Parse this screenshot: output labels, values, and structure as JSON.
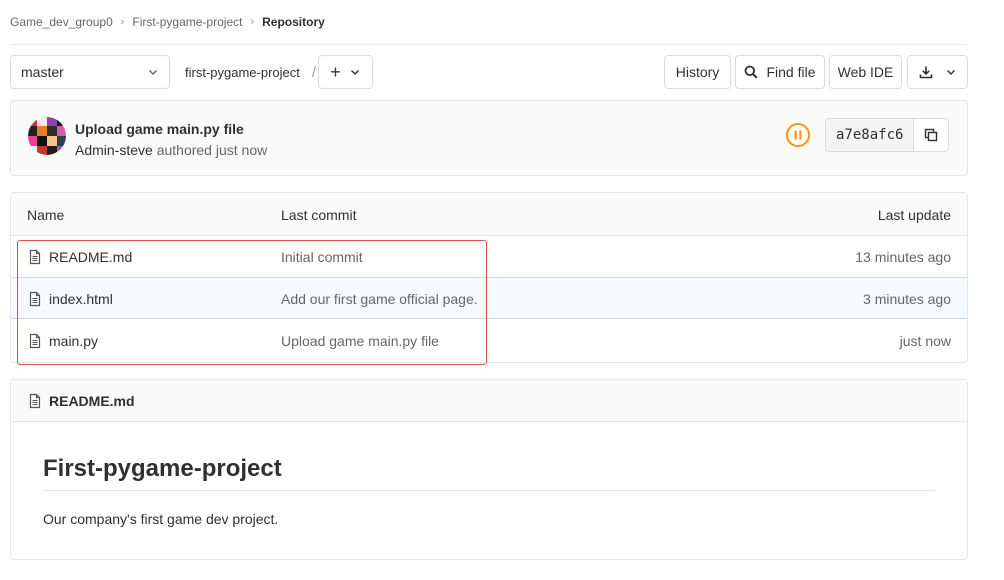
{
  "breadcrumb": {
    "items": [
      "Game_dev_group0",
      "First-pygame-project",
      "Repository"
    ]
  },
  "toolbar": {
    "branch": "master",
    "path": "first-pygame-project",
    "path_sep": "/",
    "add_label": "+",
    "history_label": "History",
    "find_file_label": "Find file",
    "web_ide_label": "Web IDE"
  },
  "commit": {
    "title": "Upload game main.py file",
    "author": "Admin-steve",
    "meta": "authored just now",
    "sha": "a7e8afc6",
    "pipeline_status": "pending"
  },
  "tree": {
    "headers": {
      "name": "Name",
      "last_commit": "Last commit",
      "last_update": "Last update"
    },
    "rows": [
      {
        "name": "README.md",
        "commit": "Initial commit",
        "updated": "13 minutes ago"
      },
      {
        "name": "index.html",
        "commit": "Add our first game official page.",
        "updated": "3 minutes ago"
      },
      {
        "name": "main.py",
        "commit": "Upload game main.py file",
        "updated": "just now"
      }
    ]
  },
  "readme": {
    "filename": "README.md",
    "heading": "First-pygame-project",
    "body": "Our company's first game dev project."
  },
  "colors": {
    "pipeline_pending": "#fc9403",
    "highlight_row": "#f6faff",
    "annotation_box": "#d9534f"
  }
}
